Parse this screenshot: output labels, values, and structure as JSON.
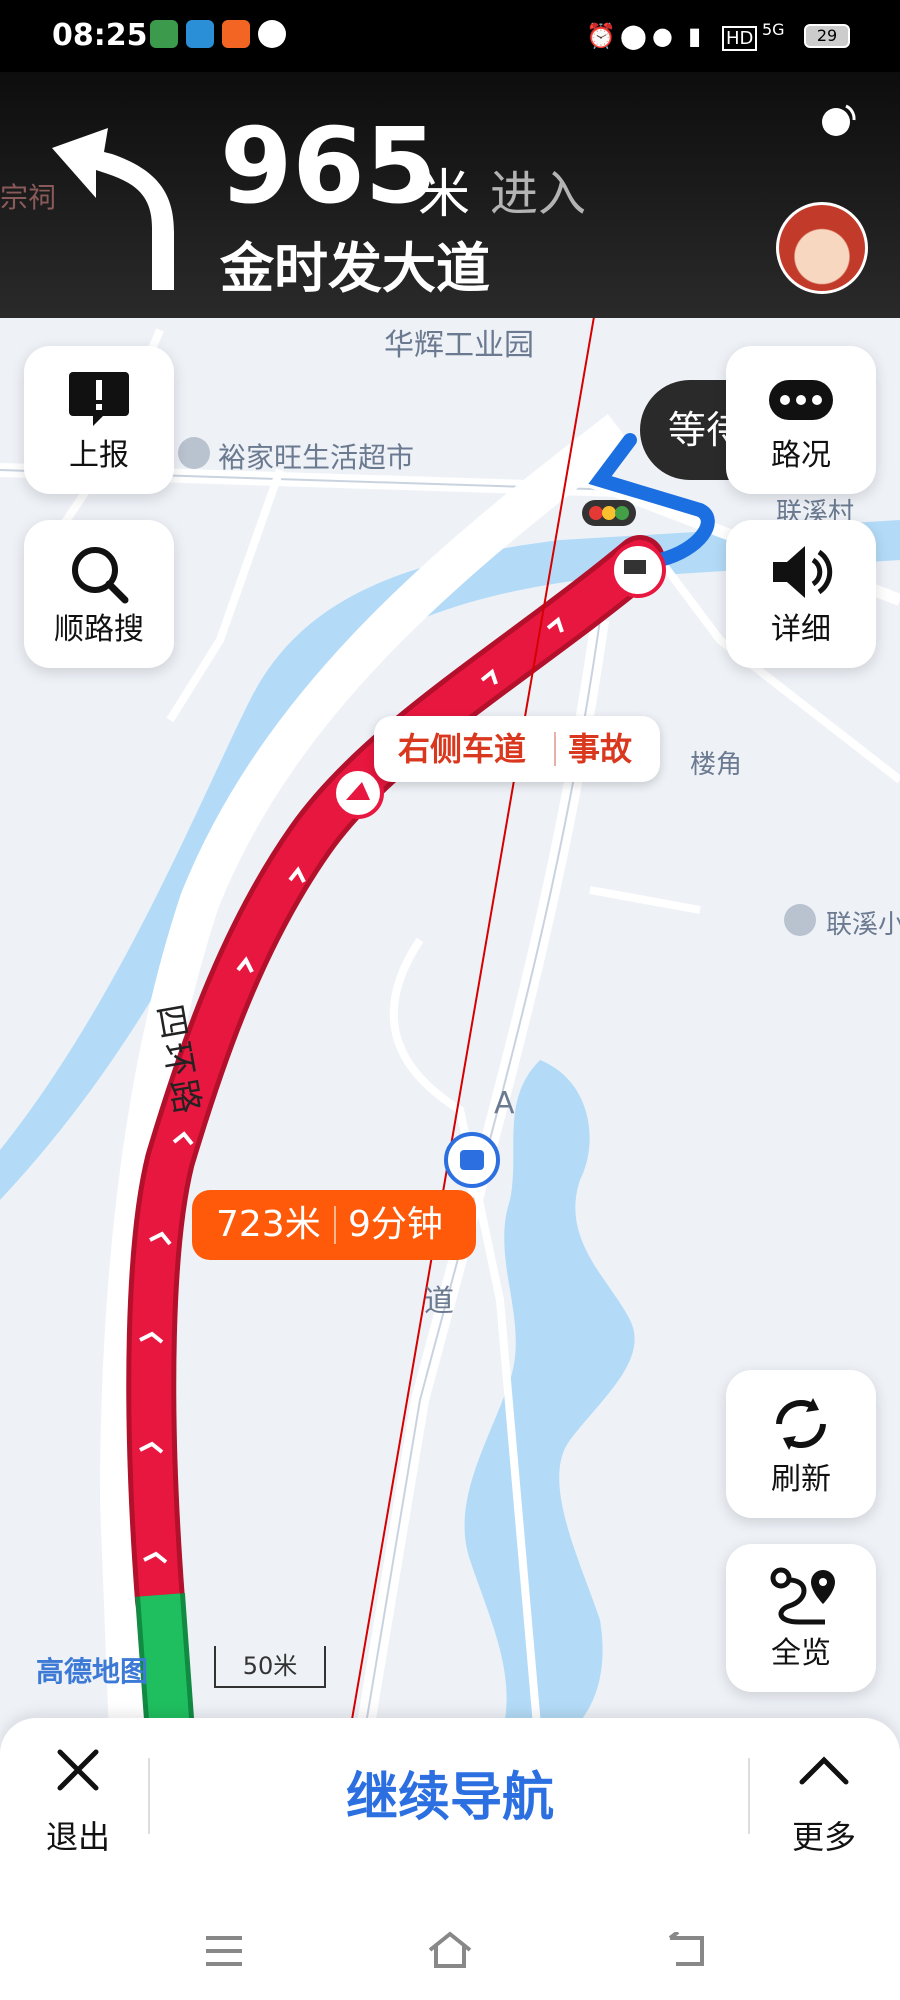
{
  "status_bar": {
    "time": "08:25",
    "network": "5G",
    "battery": "29",
    "icons": [
      "alarm-icon",
      "location-icon",
      "mic-icon",
      "vibrate-icon",
      "hd-icon",
      "signal-icon"
    ]
  },
  "nav_header": {
    "turn_icon": "turn-left-arrow-icon",
    "distance_value": "965",
    "distance_unit": "米",
    "action": "进入",
    "road_name": "金时发大道"
  },
  "map": {
    "labels": {
      "industrial_park": "华辉工业园",
      "supermarket": "裕家旺生活超市",
      "village": "联溪村",
      "lou_jiao": "楼角",
      "lianxi": "联溪小",
      "road_name": "四环路",
      "road_a": "A",
      "road_dao": "道",
      "left_partial": "宗祠"
    },
    "route_color": "#e8173f",
    "route_green": "#1fbf5f",
    "water_color": "#b3dbf7"
  },
  "incident_callout": {
    "lane": "右侧车道",
    "type": "事故"
  },
  "route_info": {
    "distance": "723米",
    "time": "9分钟"
  },
  "wait_pill": {
    "label": "等待"
  },
  "buttons": {
    "report": "上报",
    "search_along": "顺路搜",
    "traffic": "路况",
    "detail": "详细",
    "refresh": "刷新",
    "overview": "全览"
  },
  "logo": "高德地图",
  "scale": "50米",
  "bottom_bar": {
    "exit": "退出",
    "continue": "继续导航",
    "more": "更多"
  }
}
